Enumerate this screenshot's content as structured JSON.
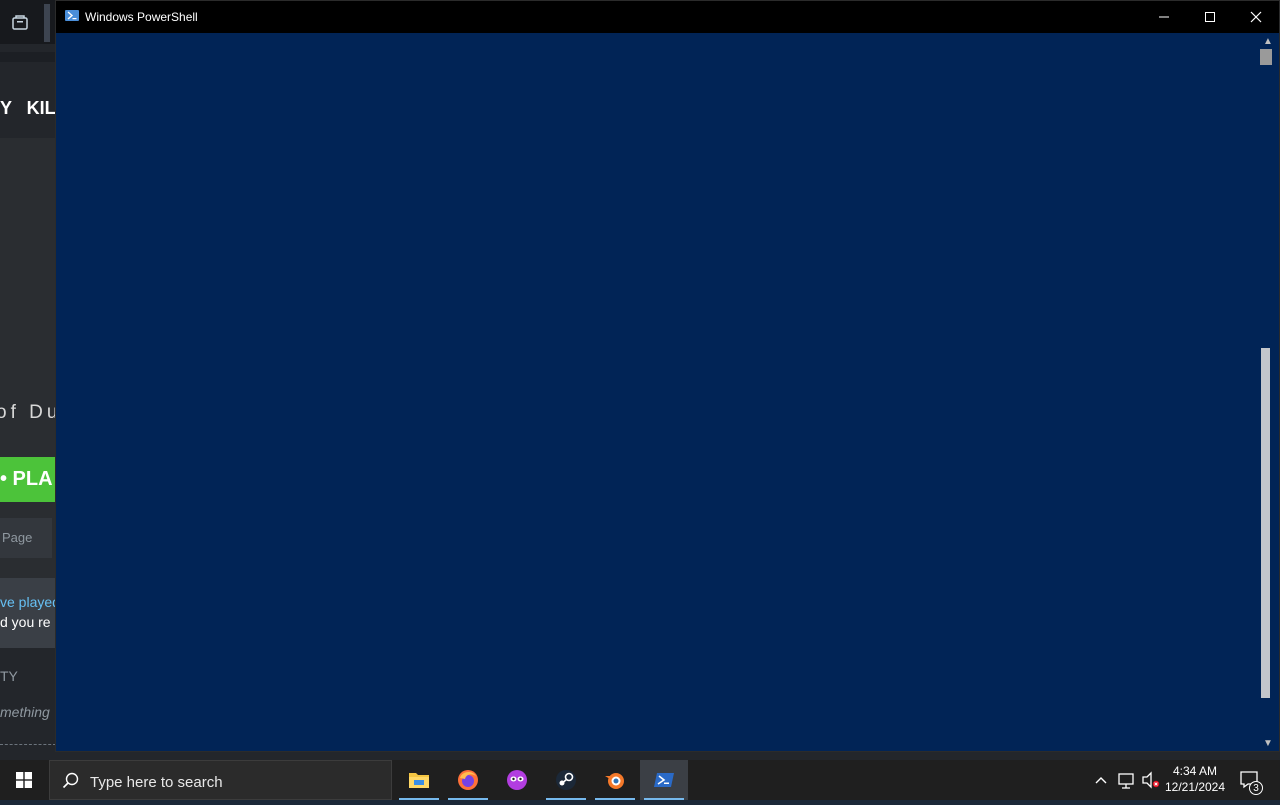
{
  "background_window": {
    "nav_text": "Y   KIL",
    "game_title": "of Du",
    "play_label": "• PLA",
    "store_page_label": "Page",
    "review_line1": "ve played",
    "review_line2": "d you re",
    "activity_label": "TY",
    "say_something": "mething"
  },
  "powershell": {
    "title": "Windows PowerShell",
    "icon": "powershell-icon",
    "colors": {
      "console_bg": "#012456",
      "titlebar_bg": "#000000"
    }
  },
  "taskbar": {
    "search_placeholder": "Type here to search",
    "apps": [
      {
        "name": "File Explorer",
        "icon": "folder-icon"
      },
      {
        "name": "Firefox",
        "icon": "firefox-icon"
      },
      {
        "name": "Media Player",
        "icon": "mask-icon"
      },
      {
        "name": "Steam",
        "icon": "steam-icon"
      },
      {
        "name": "Blender",
        "icon": "blender-icon"
      },
      {
        "name": "Windows PowerShell",
        "icon": "powershell-icon",
        "active": true
      }
    ],
    "clock": {
      "time": "4:34 AM",
      "date": "12/21/2024"
    },
    "notifications_count": "3"
  }
}
